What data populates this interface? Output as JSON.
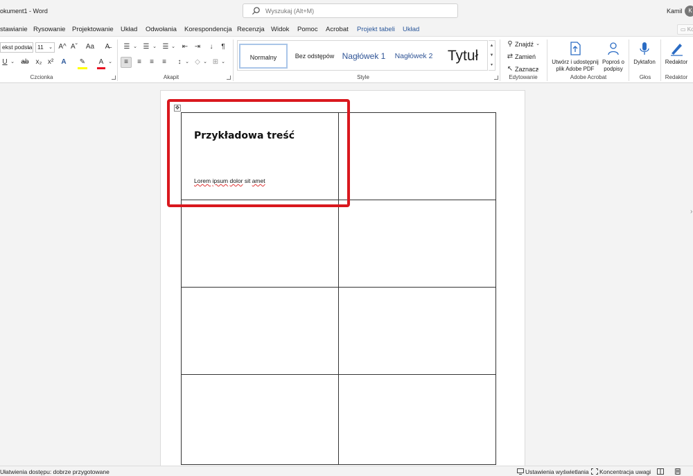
{
  "window": {
    "doc_title": "okument1 - Word",
    "user_name": "Kamil",
    "avatar_initial": "K"
  },
  "search": {
    "placeholder": "Wyszukaj (Alt+M)"
  },
  "menu": {
    "items": [
      "stawianie",
      "Rysowanie",
      "Projektowanie",
      "Układ",
      "Odwołania",
      "Korespondencja",
      "Recenzja",
      "Widok",
      "Pomoc",
      "Acrobat",
      "Projekt tabeli",
      "Układ"
    ],
    "ko_label": "Ko"
  },
  "ribbon": {
    "font": {
      "font_name": "ekst podsta",
      "font_size": "11",
      "grow_label": "A^",
      "shrink_label": "Aˇ",
      "case_label": "Aa",
      "group_label": "Czcionka"
    },
    "paragraph": {
      "group_label": "Akapit",
      "pilcrow": "¶"
    },
    "styles": {
      "group_label": "Style",
      "tiles": [
        "Normalny",
        "Bez odstępów",
        "Nagłówek 1",
        "Nagłówek 2",
        "Tytuł"
      ]
    },
    "editing": {
      "group_label": "Edytowanie",
      "find_label": "Znajdź",
      "replace_label": "Zamień",
      "select_label": "Zaznacz"
    },
    "acrobat": {
      "group_label": "Adobe Acrobat",
      "create_label_line1": "Utwórz i udostępnij",
      "create_label_line2": "plik Adobe PDF",
      "sign_label_line1": "Poproś o",
      "sign_label_line2": "podpisy"
    },
    "voice": {
      "group_label": "Głos",
      "dictate_label": "Dyktafon"
    },
    "editor": {
      "group_label": "Redaktor",
      "editor_label": "Redaktor"
    }
  },
  "document": {
    "cell_title": "Przykładowa treść",
    "cell_body_words": [
      "Lorem",
      "ipsum",
      "dolor",
      "sit",
      "amet"
    ],
    "table_rows": 4,
    "table_cols": 2
  },
  "status": {
    "accessibility": "Ułatwienia dostępu: dobrze przygotowane",
    "display_settings": "Ustawienia wyświetlania",
    "focus": "Koncentracja uwagi"
  },
  "colors": {
    "accent": "#2b579a",
    "highlight_box": "#d9181e",
    "highlight_yellow": "#ffff00",
    "font_color_red": "#e81123"
  }
}
